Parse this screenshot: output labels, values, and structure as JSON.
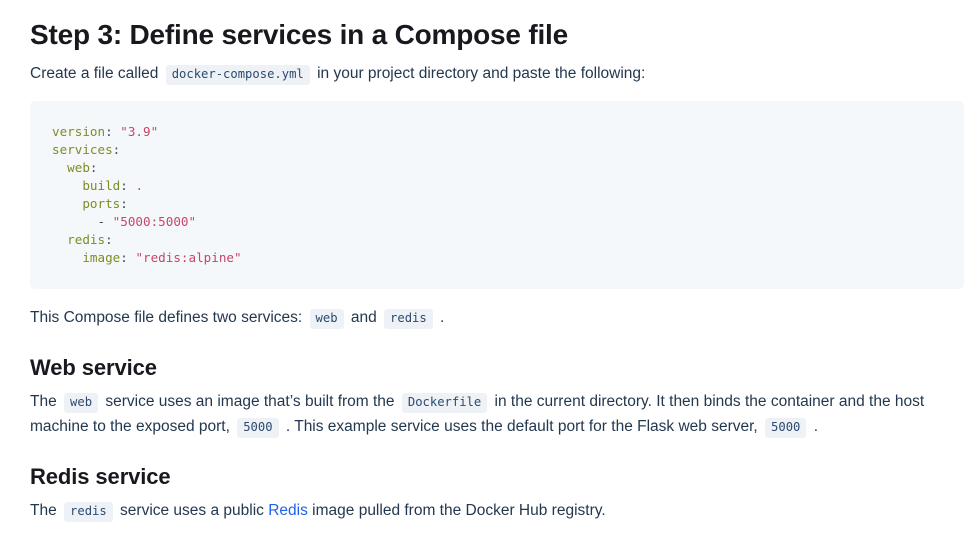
{
  "page": {
    "heading": "Step 3: Define services in a Compose file",
    "intro": {
      "before": "Create a file called",
      "code": "docker-compose.yml",
      "after": "in your project directory and paste the following:"
    },
    "code_block": {
      "language": "yaml",
      "filename": "docker-compose.yml",
      "lines": [
        {
          "indent": 0,
          "key": "version",
          "sep": ": ",
          "value": "\"3.9\"",
          "value_type": "string"
        },
        {
          "indent": 0,
          "key": "services",
          "sep": ":",
          "value": "",
          "value_type": "none"
        },
        {
          "indent": 1,
          "key": "web",
          "sep": ":",
          "value": "",
          "value_type": "none"
        },
        {
          "indent": 2,
          "key": "build",
          "sep": ": ",
          "value": ".",
          "value_type": "string"
        },
        {
          "indent": 2,
          "key": "ports",
          "sep": ":",
          "value": "",
          "value_type": "none"
        },
        {
          "indent": 3,
          "key": "",
          "sep": "- ",
          "value": "\"5000:5000\"",
          "value_type": "string"
        },
        {
          "indent": 1,
          "key": "redis",
          "sep": ":",
          "value": "",
          "value_type": "none"
        },
        {
          "indent": 2,
          "key": "image",
          "sep": ": ",
          "value": "\"redis:alpine\"",
          "value_type": "string"
        }
      ],
      "raw": "version: \"3.9\"\nservices:\n  web:\n    build: .\n    ports:\n      - \"5000:5000\"\n  redis:\n    image: \"redis:alpine\""
    },
    "summary": {
      "before": "This Compose file defines two services:",
      "code_one": "web",
      "middle": "and",
      "code_two": "redis",
      "after": "."
    },
    "web_section": {
      "heading": "Web service",
      "t1": "The",
      "c1": "web",
      "t2": "service uses an image that’s built from the",
      "c2": "Dockerfile",
      "t3": "in the current directory. It then binds the container and the host machine to the exposed port,",
      "c3": "5000",
      "t4": ". This example service uses the default port for the Flask web server,",
      "c4": "5000",
      "t5": "."
    },
    "redis_section": {
      "heading": "Redis service",
      "t1": "The",
      "c1": "redis",
      "t2": "service uses a public",
      "link": "Redis",
      "t3": "image pulled from the Docker Hub registry."
    }
  },
  "colors": {
    "page_background": "#ffffff",
    "heading_text": "#17191e",
    "body_text": "#23384f",
    "link": "#1d63ed",
    "code_block_background": "#f4f8fb",
    "inline_code_background": "#eef2f7",
    "inline_code_text": "#2b4a6f",
    "yaml_key": "#7f8c1f",
    "yaml_string": "#c7466a",
    "yaml_punctuation": "#3b4d5c"
  }
}
